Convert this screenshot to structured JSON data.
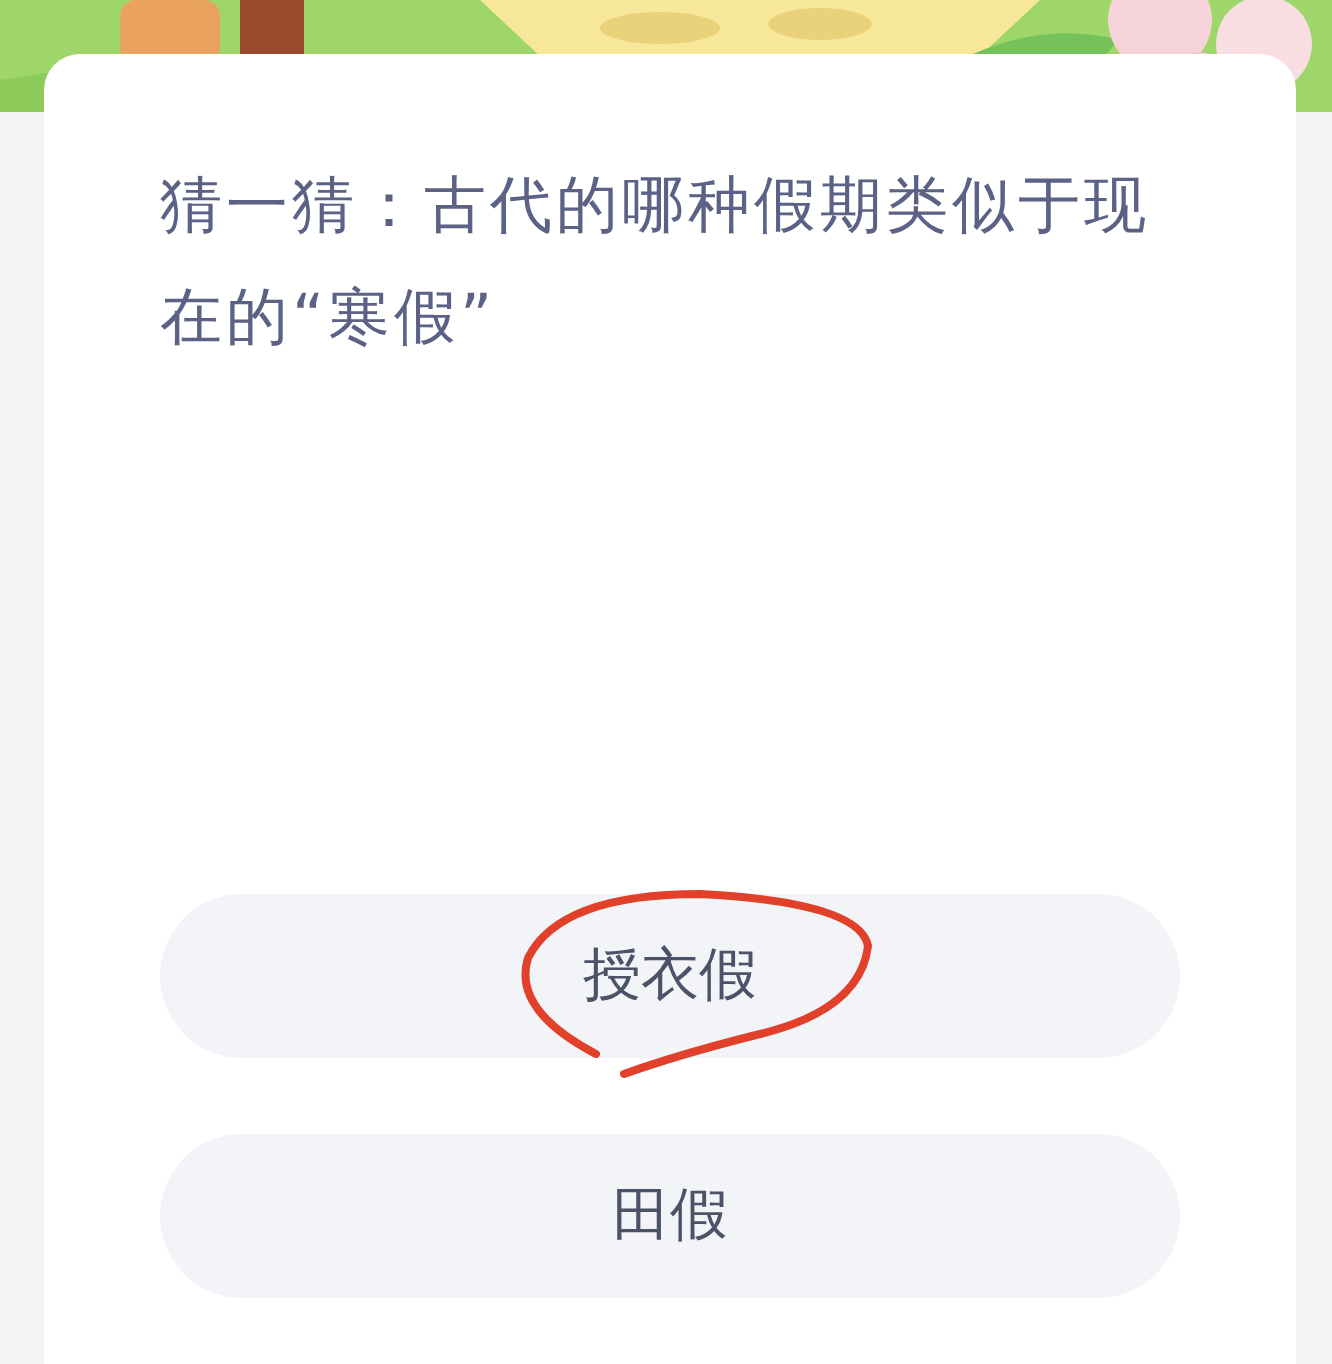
{
  "question": "猜一猜：古代的哪种假期类似于现在的“寒假”",
  "options": [
    {
      "label": "授衣假",
      "marked": true
    },
    {
      "label": "田假",
      "marked": false
    }
  ]
}
